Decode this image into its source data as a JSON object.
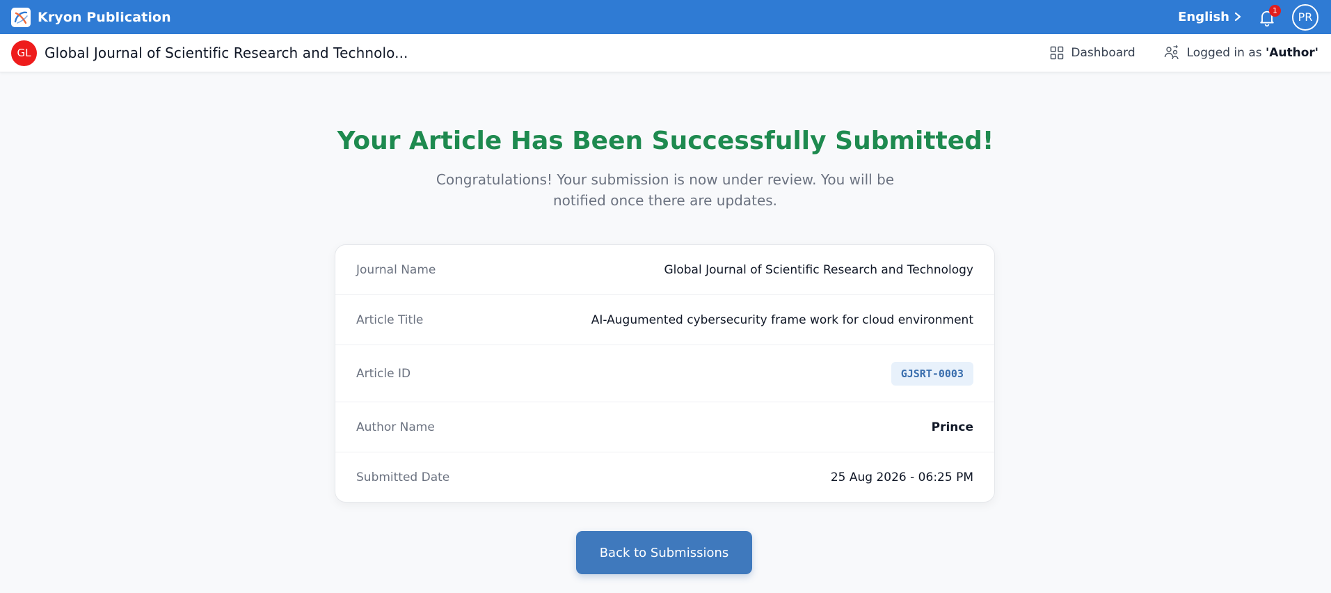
{
  "app": {
    "brand_name": "Kryon Publication",
    "language": "English",
    "notification_count": "1",
    "user_initials": "PR"
  },
  "subheader": {
    "journal_initials": "GL",
    "journal_title": "Global Journal of Scientific Research and Technolo...",
    "dashboard_label": "Dashboard",
    "logged_in_prefix": "Logged in as",
    "logged_in_role": "'Author'"
  },
  "confirmation": {
    "title": "Your Article Has Been Successfully Submitted!",
    "subtitle": "Congratulations! Your submission is now under review. You will be notified once there are updates."
  },
  "details": [
    {
      "label": "Journal Name",
      "value": "Global Journal of Scientific Research and Technology"
    },
    {
      "label": "Article Title",
      "value": "AI-Augumented cybersecurity frame work for cloud environment"
    },
    {
      "label": "Article ID",
      "value": "GJSRT-0003"
    },
    {
      "label": "Author Name",
      "value": "Prince"
    },
    {
      "label": "Submitted Date",
      "value": "25 Aug 2026 - 06:25 PM"
    }
  ],
  "actions": {
    "back_label": "Back to Submissions"
  },
  "colors": {
    "topbar": "#2f7bd4",
    "success": "#1e8a4f",
    "button": "#3f79bd",
    "journal_badge": "#ee1c1c",
    "notification_badge": "#e11d1d"
  },
  "icons": {
    "brand": "kryon-logo-icon",
    "language_chevron": "chevron-right-icon",
    "notifications": "bell-icon",
    "dashboard": "grid-icon",
    "role": "users-switch-icon"
  }
}
